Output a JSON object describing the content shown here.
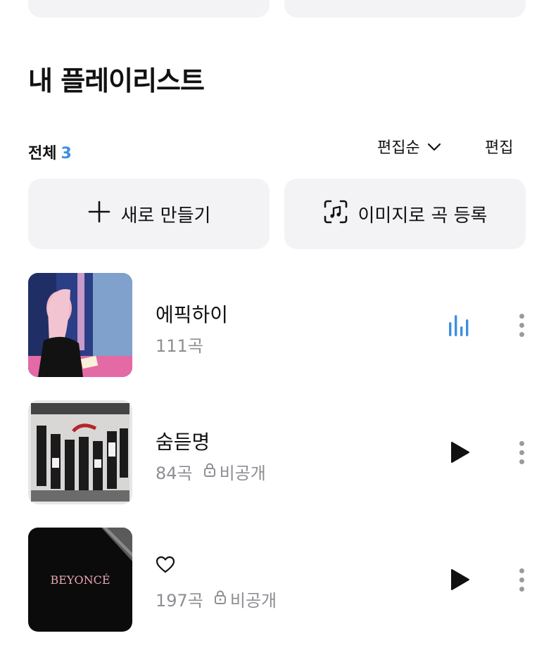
{
  "header": {
    "title": "내 플레이리스트"
  },
  "filter": {
    "total_label": "전체",
    "total_count": "3",
    "sort_label": "편집순",
    "edit_label": "편집"
  },
  "actions": {
    "create_label": "새로 만들기",
    "image_add_label": "이미지로 곡 등록"
  },
  "playlists": [
    {
      "name": "에픽하이",
      "count": "111곡",
      "privacy": "",
      "state": "playing"
    },
    {
      "name": "숨듣명",
      "count": "84곡",
      "privacy": "비공개",
      "state": "paused"
    },
    {
      "name": "",
      "count": "197곡",
      "privacy": "비공개",
      "state": "paused"
    }
  ],
  "covers": {
    "third_cover_text": "BEYONCÉ"
  },
  "colors": {
    "accent": "#3d8fe0",
    "card_bg": "#f3f3f5",
    "muted": "#8e8e93"
  }
}
